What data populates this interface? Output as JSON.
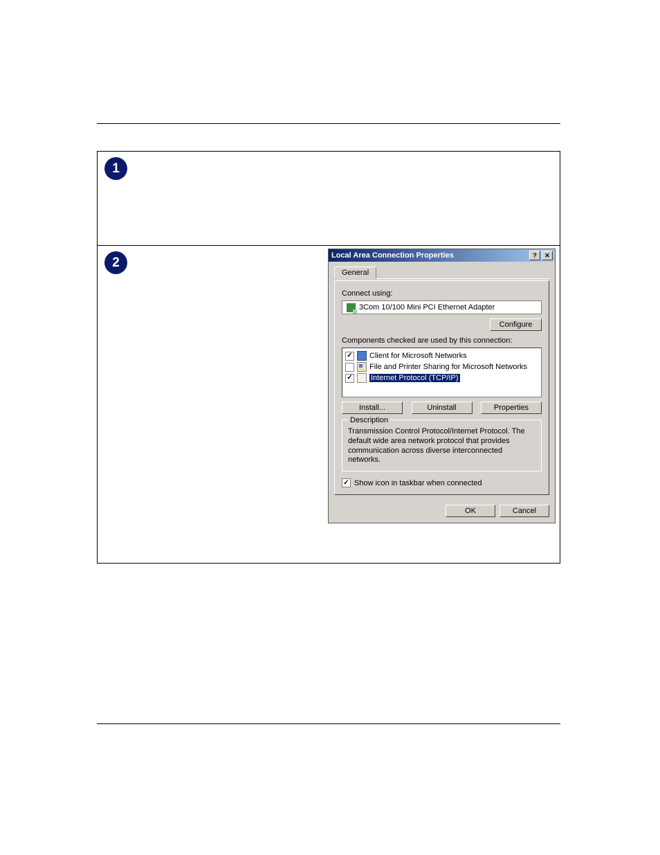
{
  "steps": {
    "one": "1",
    "two": "2"
  },
  "dialog": {
    "title": "Local Area Connection Properties",
    "help_btn": "?",
    "close_btn": "✕",
    "tab": "General",
    "connect_using_label": "Connect using:",
    "adapter_name": "3Com 10/100 Mini PCI Ethernet Adapter",
    "configure_btn": "Configure",
    "components_label": "Components checked are used by this connection:",
    "components": {
      "client": {
        "checked": true,
        "text": "Client for Microsoft Networks"
      },
      "share": {
        "checked": false,
        "text": "File and Printer Sharing for Microsoft Networks"
      },
      "tcpip": {
        "checked": true,
        "text": "Internet Protocol (TCP/IP)"
      }
    },
    "install_btn": "Install...",
    "uninstall_btn": "Uninstall",
    "properties_btn": "Properties",
    "description_legend": "Description",
    "description_text": "Transmission Control Protocol/Internet Protocol. The default wide area network protocol that provides communication across diverse interconnected networks.",
    "show_icon_label": "Show icon in taskbar when connected",
    "show_icon_checked": true,
    "ok_btn": "OK",
    "cancel_btn": "Cancel"
  }
}
